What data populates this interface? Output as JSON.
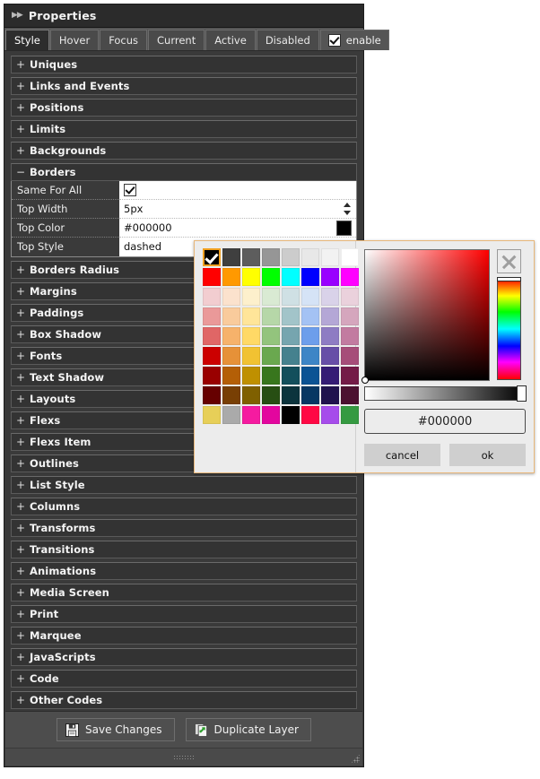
{
  "window": {
    "title": "Properties",
    "collapse_icon": "double-right-arrow-icon"
  },
  "tabs": [
    {
      "label": "Style",
      "active": true
    },
    {
      "label": "Hover",
      "active": false
    },
    {
      "label": "Focus",
      "active": false
    },
    {
      "label": "Current",
      "active": false
    },
    {
      "label": "Active",
      "active": false
    },
    {
      "label": "Disabled",
      "active": false
    }
  ],
  "enable_toggle": {
    "label": "enable",
    "checked": true
  },
  "sections": [
    {
      "label": "Uniques",
      "sign": "+",
      "expanded": false
    },
    {
      "label": "Links and Events",
      "sign": "+",
      "expanded": false
    },
    {
      "label": "Positions",
      "sign": "+",
      "expanded": false
    },
    {
      "label": "Limits",
      "sign": "+",
      "expanded": false
    },
    {
      "label": "Backgrounds",
      "sign": "+",
      "expanded": false
    },
    {
      "label": "Borders",
      "sign": "−",
      "expanded": true
    },
    {
      "label": "Borders Radius",
      "sign": "+",
      "expanded": false
    },
    {
      "label": "Margins",
      "sign": "+",
      "expanded": false
    },
    {
      "label": "Paddings",
      "sign": "+",
      "expanded": false
    },
    {
      "label": "Box Shadow",
      "sign": "+",
      "expanded": false
    },
    {
      "label": "Fonts",
      "sign": "+",
      "expanded": false
    },
    {
      "label": "Text Shadow",
      "sign": "+",
      "expanded": false
    },
    {
      "label": "Layouts",
      "sign": "+",
      "expanded": false
    },
    {
      "label": "Flexs",
      "sign": "+",
      "expanded": false
    },
    {
      "label": "Flexs Item",
      "sign": "+",
      "expanded": false
    },
    {
      "label": "Outlines",
      "sign": "+",
      "expanded": false
    },
    {
      "label": "List Style",
      "sign": "+",
      "expanded": false
    },
    {
      "label": "Columns",
      "sign": "+",
      "expanded": false
    },
    {
      "label": "Transforms",
      "sign": "+",
      "expanded": false
    },
    {
      "label": "Transitions",
      "sign": "+",
      "expanded": false
    },
    {
      "label": "Animations",
      "sign": "+",
      "expanded": false
    },
    {
      "label": "Media Screen",
      "sign": "+",
      "expanded": false
    },
    {
      "label": "Print",
      "sign": "+",
      "expanded": false
    },
    {
      "label": "Marquee",
      "sign": "+",
      "expanded": false
    },
    {
      "label": "JavaScripts",
      "sign": "+",
      "expanded": false
    },
    {
      "label": "Code",
      "sign": "+",
      "expanded": false
    },
    {
      "label": "Other Codes",
      "sign": "+",
      "expanded": false
    }
  ],
  "borders_form": {
    "rows": [
      {
        "name": "Same For All",
        "type": "checkbox",
        "value": "",
        "checked": true
      },
      {
        "name": "Top Width",
        "type": "spinner",
        "value": "5px"
      },
      {
        "name": "Top Color",
        "type": "color",
        "value": "#000000",
        "swatch": "#000000"
      },
      {
        "name": "Top Style",
        "type": "text",
        "value": "dashed"
      }
    ]
  },
  "footer": {
    "save_label": "Save Changes",
    "save_icon": "floppy-disk-icon",
    "duplicate_label": "Duplicate Layer",
    "duplicate_icon": "duplicate-layer-icon"
  },
  "color_picker": {
    "close_icon": "close-x-icon",
    "hex_value": "#000000",
    "cancel_label": "cancel",
    "ok_label": "ok",
    "selected_swatch_index": 0,
    "accent_border": "#e8b77a",
    "selection_outline": "#f0a020",
    "swatches": [
      "#000000",
      "#3f3f3f",
      "#5d5d5d",
      "#969696",
      "#cccccc",
      "#e8e8e8",
      "#f2f2f2",
      "#ffffff",
      "#ff0000",
      "#ff9900",
      "#ffff00",
      "#00ff00",
      "#00ffff",
      "#0000ff",
      "#9900ff",
      "#ff00ff",
      "#f2cdd0",
      "#fbe2cd",
      "#fdf0cc",
      "#d9ead3",
      "#cfe0e4",
      "#d5e3f6",
      "#d9d2e9",
      "#ead1dc",
      "#ea9999",
      "#f9cb9c",
      "#ffe599",
      "#b6d7a8",
      "#a2c4c9",
      "#a4c2f4",
      "#b4a7d6",
      "#d5a6bd",
      "#e06666",
      "#f6b26b",
      "#ffd966",
      "#93c47d",
      "#76a5af",
      "#6d9eeb",
      "#8e7cc3",
      "#c27ba0",
      "#cc0000",
      "#e69138",
      "#f1c232",
      "#6aa84f",
      "#45818e",
      "#3d85c6",
      "#674ea7",
      "#a64d79",
      "#990000",
      "#b45f06",
      "#bf9000",
      "#38761d",
      "#134f5c",
      "#0b5394",
      "#351c75",
      "#741b47",
      "#660000",
      "#783f04",
      "#7f6000",
      "#274e13",
      "#0c343d",
      "#073763",
      "#20124d",
      "#4c1130",
      "#e7cf58",
      "#aaaaaa",
      "#f51ba0",
      "#e3069e",
      "#000000",
      "#ff0844",
      "#a64ceb",
      "#359a41"
    ]
  }
}
